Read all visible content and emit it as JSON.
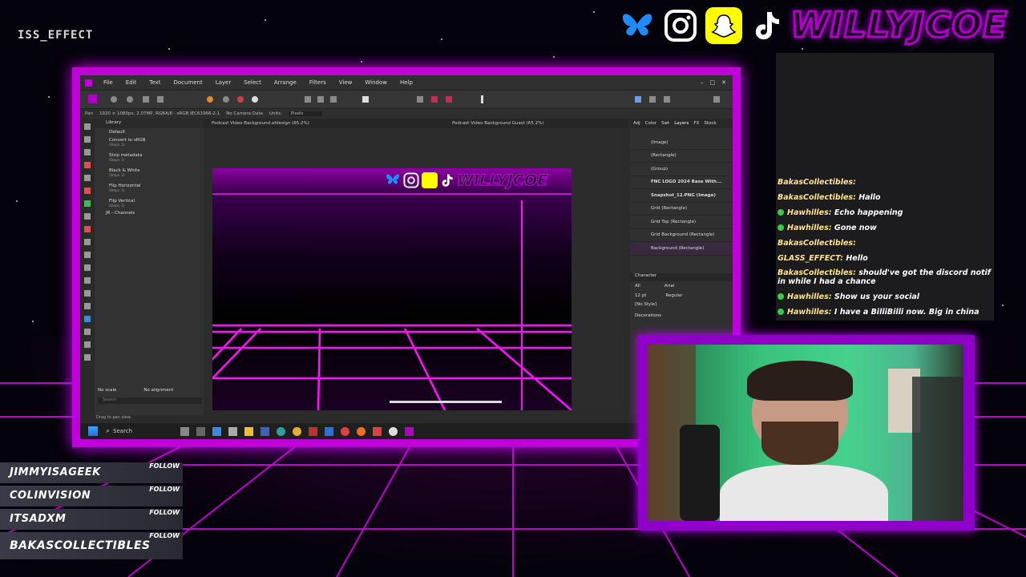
{
  "overlay": {
    "top_left_text": "ISS_EFFECT",
    "brand_name": "WILLYJCOE",
    "social_icons": [
      "bluesky-icon",
      "instagram-icon",
      "snapchat-icon",
      "tiktok-icon"
    ],
    "accent_color": "#c000d8"
  },
  "app": {
    "menu": [
      "File",
      "Edit",
      "Text",
      "Document",
      "Layer",
      "Select",
      "Arrange",
      "Filters",
      "View",
      "Window",
      "Help"
    ],
    "context_bar": {
      "pan_label": "Pan",
      "doc_info": "1920 × 1080px, 2.07MP, RGBA/8 - sRGB IEC61966-2.1",
      "camera": "No Camera Data",
      "units_label": "Units:",
      "units_value": "Pixels"
    },
    "tabs": [
      "Podcast Video Background.afdesign (65.2%)",
      "Podcast Video Background Guest (65.2%)"
    ],
    "library": {
      "title": "Library",
      "group": "Default",
      "items": [
        {
          "name": "Convert to sRGB",
          "steps": "(Steps: 2)"
        },
        {
          "name": "Strip metadata",
          "steps": "(Steps: 1)"
        },
        {
          "name": "Black & White",
          "steps": "(Steps: 2)"
        },
        {
          "name": "Flip Horizontal",
          "steps": "(Steps: 1)"
        },
        {
          "name": "Flip Vertical",
          "steps": "(Steps: 1)"
        }
      ],
      "subgroup": "JR - Channels",
      "scale": "No scale",
      "alignment": "No alignment",
      "search_placeholder": "Search"
    },
    "doc_brand": "WILLYJCOE",
    "right_tabs": [
      "Adj",
      "Color",
      "Swt",
      "Layers",
      "FX",
      "Stock"
    ],
    "layers": [
      {
        "name": "(Image)"
      },
      {
        "name": "(Rectangle)"
      },
      {
        "name": "(Group)"
      },
      {
        "name": "FNC LOGO 2024 Base With..."
      },
      {
        "name": "Snapshot_12.PNG (Image)"
      },
      {
        "name": "Grid (Rectangle)"
      },
      {
        "name": "Grid Top (Rectangle)"
      },
      {
        "name": "Grid Background (Rectangle)"
      },
      {
        "name": "Background (Rectangle)"
      }
    ],
    "character": {
      "title": "Character",
      "scope": "All",
      "font": "Arial",
      "size": "12 pt",
      "weight": "Regular",
      "style": "[No Style]",
      "decorations": "Decorations"
    },
    "status_hint": "Drag to pan view.",
    "taskbar_search": "Search"
  },
  "chat": {
    "messages": [
      {
        "user": "BakasCollectibles:",
        "text": "",
        "mod": false
      },
      {
        "user": "BakasCollectibles:",
        "text": "Hallo",
        "mod": false
      },
      {
        "user": "Hawhilles:",
        "text": "Echo happening",
        "mod": true
      },
      {
        "user": "Hawhilles:",
        "text": "Gone now",
        "mod": true
      },
      {
        "user": "BakasCollectibles:",
        "text": "",
        "mod": false
      },
      {
        "user": "GLASS_EFFECT:",
        "text": "Hello",
        "mod": false
      },
      {
        "user": "BakasCollectibles:",
        "text": "should've got the discord notif",
        "mod": false
      },
      {
        "user": "",
        "text": "in while I had a chance",
        "mod": false
      },
      {
        "user": "Hawhilles:",
        "text": "Show us your social",
        "mod": true
      },
      {
        "user": "Hawhilles:",
        "text": "I have a BilliBilli now. Big in china",
        "mod": true
      }
    ]
  },
  "follows": {
    "button_label": "FOLLOW",
    "names": [
      "JIMMYISAGEEK",
      "COLINVISION",
      "ITSADXM",
      "BAKASCOLLECTIBLES"
    ]
  }
}
